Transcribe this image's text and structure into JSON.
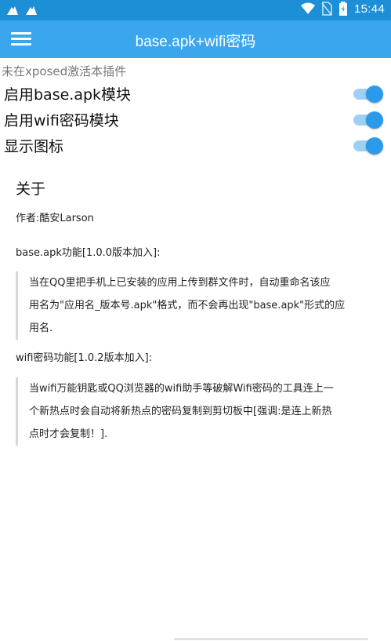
{
  "statusbar": {
    "time": "15:44",
    "left_icons": [
      "notification-icon",
      "notification-icon"
    ],
    "right_icons": [
      "wifi-icon",
      "no-sim-icon",
      "battery-icon"
    ]
  },
  "appbar": {
    "title": "base.apk+wifi密码",
    "color": "#3aa6ee"
  },
  "notice": "未在xposed激活本插件",
  "settings": [
    {
      "label": "启用base.apk模块",
      "enabled": true
    },
    {
      "label": "启用wifi密码模块",
      "enabled": true
    },
    {
      "label": "显示图标",
      "enabled": true
    }
  ],
  "about": {
    "title": "关于",
    "author": "作者:酷安Larson",
    "feature1_title": "base.apk功能[1.0.0版本加入]:",
    "feature1_lines": [
      "当在QQ里把手机上已安装的应用上传到群文件时，自动重命名该应",
      "用名为\"应用名_版本号.apk\"格式，而不会再出现\"base.apk\"形式的应",
      "用名."
    ],
    "feature2_title": "wifi密码功能[1.0.2版本加入]:",
    "feature2_lines": [
      "当wifi万能钥匙或QQ浏览器的wifi助手等破解Wifi密码的工具连上一",
      "个新热点时会自动将新热点的密码复制到剪切板中[强调:是连上新热",
      "点时才会复制！]."
    ]
  }
}
